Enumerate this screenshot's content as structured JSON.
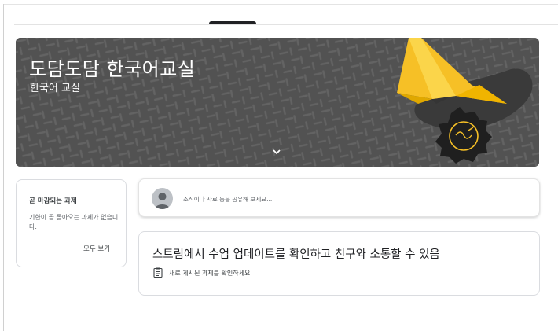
{
  "banner": {
    "title": "도담도담 한국어교실",
    "subtitle": "한국어 교실"
  },
  "due_card": {
    "title": "곧 마감되는 과제",
    "empty_text": "기한이 곧 돌아오는 과제가 없습니다.",
    "view_all": "모두 보기"
  },
  "announce": {
    "placeholder": "소식이나 자료 등을 공유해 보세요..."
  },
  "stream_info": {
    "heading": "스트림에서 수업 업데이트를 확인하고 친구와 소통할 수 있음",
    "subtext": "새로 게시된 과제를 확인하세요"
  },
  "icons": {
    "chevron": "chevron-down-icon",
    "avatar": "account-avatar-icon",
    "assignment": "assignment-icon"
  },
  "colors": {
    "banner_bg": "#5a5a5a",
    "accent_yellow": "#f6c026",
    "card_border": "#dadce0"
  }
}
